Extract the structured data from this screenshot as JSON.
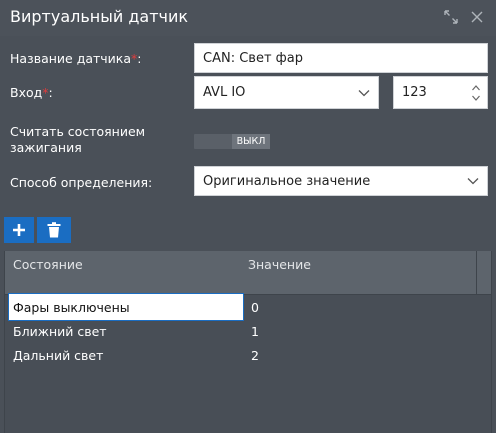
{
  "window": {
    "title": "Виртуальный датчик"
  },
  "form": {
    "sensor_name_label": "Название датчика",
    "sensor_name_value": "CAN: Свет фар",
    "required_mark": "*",
    "colon": ":",
    "input_label": "Вход",
    "input_value": "AVL IO",
    "input_number": "123",
    "ignition_label_line1": "Считать состоянием",
    "ignition_label_line2": "зажигания",
    "ignition_toggle_text": "ВЫКЛ",
    "method_label": "Способ определения:",
    "method_value": "Оригинальное значение"
  },
  "table": {
    "columns": [
      "Состояние",
      "Значение"
    ],
    "rows": [
      {
        "state": "Фары выключены",
        "value": "0"
      },
      {
        "state": "Ближний свет",
        "value": "1"
      },
      {
        "state": "Дальний свет",
        "value": "2"
      }
    ]
  },
  "colors": {
    "accent": "#1a6dc2",
    "background": "#4a5058",
    "header": "#5d646c",
    "required": "#e23d3d"
  },
  "icons": {
    "expand": "expand-icon",
    "close": "close-icon",
    "add": "plus-icon",
    "delete": "trash-icon",
    "dropdown": "chevron-down-icon",
    "spinner": "spinner-arrows-icon"
  }
}
